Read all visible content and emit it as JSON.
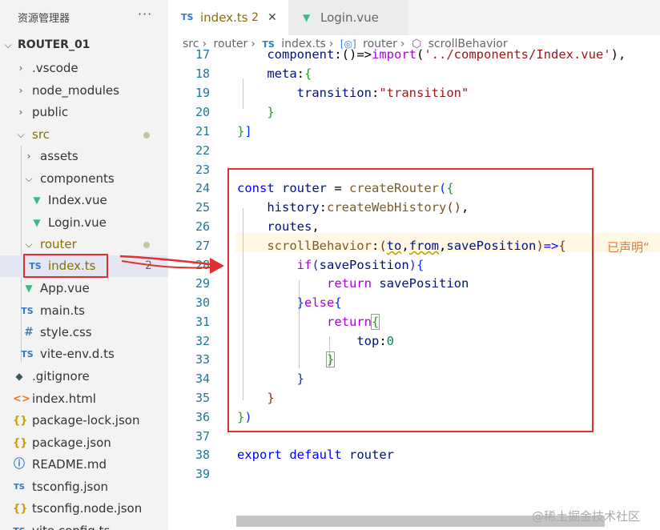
{
  "explorer": {
    "title": "资源管理器",
    "more": "···",
    "root": "ROUTER_01"
  },
  "tree": [
    {
      "label": ".vscode"
    },
    {
      "label": "node_modules"
    },
    {
      "label": "public"
    },
    {
      "label": "src"
    },
    {
      "label": "assets"
    },
    {
      "label": "components"
    },
    {
      "label": "Index.vue"
    },
    {
      "label": "Login.vue"
    },
    {
      "label": "router"
    },
    {
      "label": "index.ts",
      "badge": "2"
    },
    {
      "label": "App.vue"
    },
    {
      "label": "main.ts"
    },
    {
      "label": "style.css"
    },
    {
      "label": "vite-env.d.ts"
    },
    {
      "label": ".gitignore"
    },
    {
      "label": "index.html"
    },
    {
      "label": "package-lock.json"
    },
    {
      "label": "package.json"
    },
    {
      "label": "README.md"
    },
    {
      "label": "tsconfig.json"
    },
    {
      "label": "tsconfig.node.json"
    },
    {
      "label": "vite.config.ts"
    }
  ],
  "tabs": [
    {
      "label": "index.ts",
      "icon": "TS",
      "badge": "2",
      "close": "✕"
    },
    {
      "label": "Login.vue"
    }
  ],
  "breadcrumb": [
    "src",
    "router",
    "index.ts",
    "router",
    "scrollBehavior"
  ],
  "line_numbers": [
    "17",
    "18",
    "19",
    "20",
    "21",
    "22",
    "23",
    "24",
    "25",
    "26",
    "27",
    "28",
    "29",
    "30",
    "31",
    "32",
    "33",
    "34",
    "35",
    "36",
    "37",
    "38",
    "39"
  ],
  "inlay_hint": "已声明“",
  "watermark": "@稀土掘金技术社区"
}
